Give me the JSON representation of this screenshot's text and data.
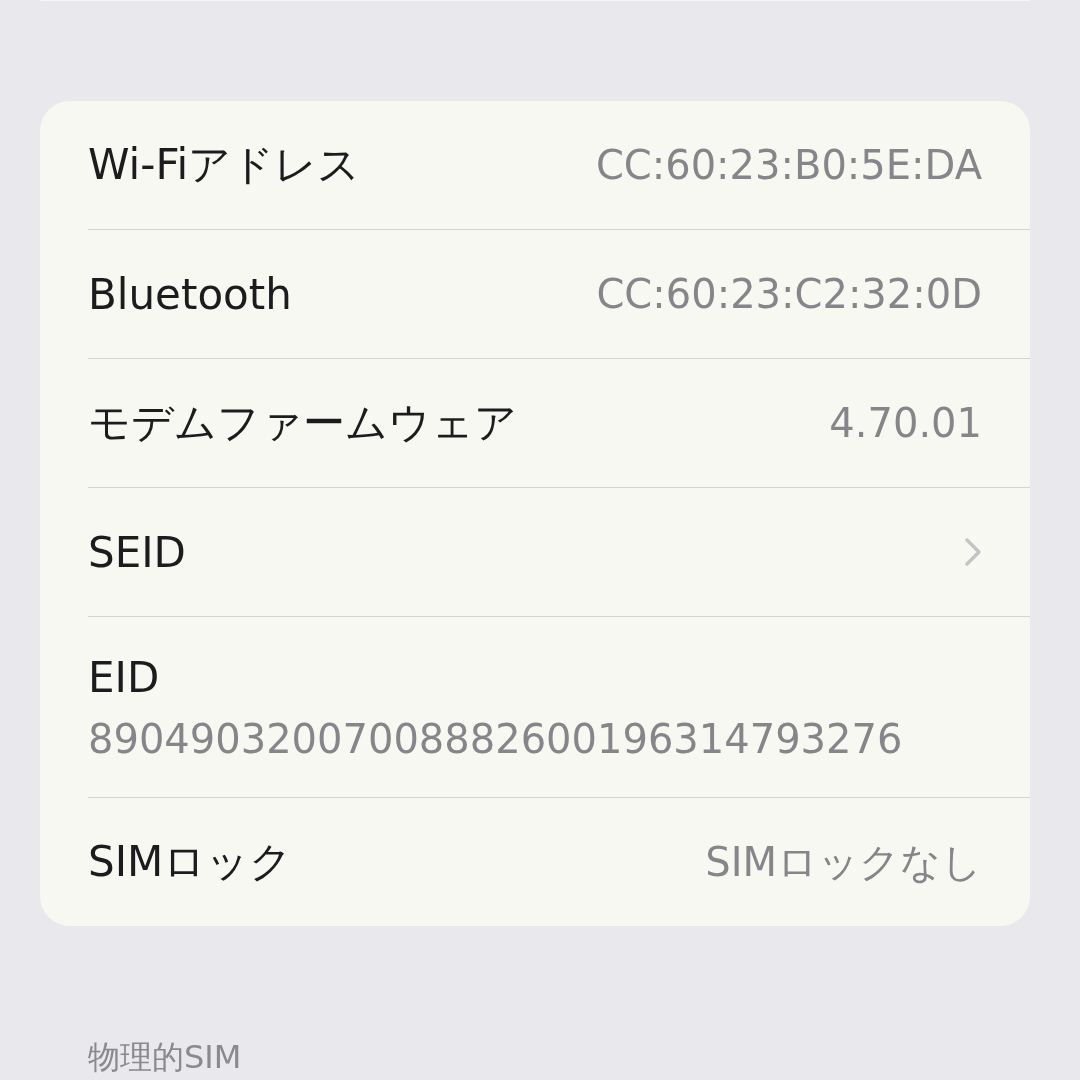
{
  "rows": [
    {
      "kind": "value",
      "label": "Wi-Fiアドレス",
      "value": "CC:60:23:B0:5E:DA"
    },
    {
      "kind": "value",
      "label": "Bluetooth",
      "value": "CC:60:23:C2:32:0D"
    },
    {
      "kind": "value",
      "label": "モデムファームウェア",
      "value": "4.70.01"
    },
    {
      "kind": "chevron",
      "label": "SEID"
    },
    {
      "kind": "stacked",
      "label": "EID",
      "value": "89049032007008882600196314793276"
    },
    {
      "kind": "value",
      "label": "SIMロック",
      "value": "SIMロックなし"
    }
  ],
  "next_section": {
    "header": "物理的SIM"
  }
}
